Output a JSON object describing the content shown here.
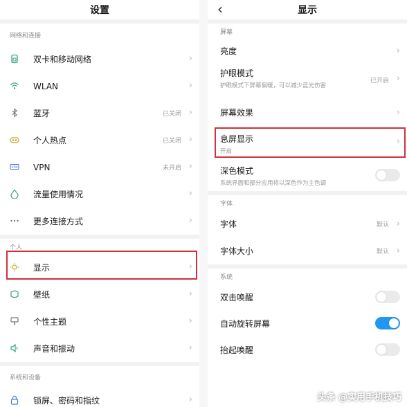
{
  "left": {
    "title": "设置",
    "sections": [
      {
        "header": "网络和连接",
        "items": [
          {
            "icon": "sim-card-icon",
            "label": "双卡和移动网络",
            "value": ""
          },
          {
            "icon": "wifi-icon",
            "label": "WLAN",
            "value": ""
          },
          {
            "icon": "bluetooth-icon",
            "label": "蓝牙",
            "value": "已关闭"
          },
          {
            "icon": "hotspot-icon",
            "label": "个人热点",
            "value": "已关闭"
          },
          {
            "icon": "vpn-icon",
            "label": "VPN",
            "value": "未开启"
          },
          {
            "icon": "data-usage-icon",
            "label": "流量使用情况",
            "value": ""
          },
          {
            "icon": "more-connections-icon",
            "label": "更多连接方式",
            "value": ""
          }
        ]
      },
      {
        "header": "个人",
        "items": [
          {
            "icon": "display-icon",
            "label": "显示",
            "value": ""
          },
          {
            "icon": "wallpaper-icon",
            "label": "壁纸",
            "value": ""
          },
          {
            "icon": "theme-icon",
            "label": "个性主题",
            "value": ""
          },
          {
            "icon": "sound-icon",
            "label": "声音和振动",
            "value": ""
          }
        ]
      },
      {
        "header": "系统和设备",
        "items": [
          {
            "icon": "lock-icon",
            "label": "锁屏、密码和指纹",
            "value": ""
          }
        ]
      }
    ]
  },
  "right": {
    "title": "显示",
    "sections": [
      {
        "header": "屏幕",
        "items": [
          {
            "label": "亮度",
            "sub": "",
            "value": "",
            "control": "chevron"
          },
          {
            "label": "护眼模式",
            "sub": "护眼模式下屏幕偏暖，可以减少蓝光伤害",
            "value": "已开启",
            "control": "chevron"
          },
          {
            "label": "屏幕效果",
            "sub": "",
            "value": "",
            "control": "chevron"
          },
          {
            "label": "息屏显示",
            "sub": "开启",
            "value": "",
            "control": "chevron"
          },
          {
            "label": "深色模式",
            "sub": "系统界面和部分应用将以深色作为主色调",
            "value": "",
            "control": "toggle",
            "on": false
          }
        ]
      },
      {
        "header": "字体",
        "items": [
          {
            "label": "字体",
            "sub": "",
            "value": "默认",
            "control": "chevron"
          },
          {
            "label": "字体大小",
            "sub": "",
            "value": "默认",
            "control": "chevron"
          }
        ]
      },
      {
        "header": "系统",
        "items": [
          {
            "label": "双击唤醒",
            "sub": "",
            "value": "",
            "control": "toggle",
            "on": false
          },
          {
            "label": "自动旋转屏幕",
            "sub": "",
            "value": "",
            "control": "toggle",
            "on": true
          },
          {
            "label": "抬起唤醒",
            "sub": "",
            "value": "",
            "control": "toggle",
            "on": false
          }
        ]
      }
    ]
  },
  "colors": {
    "highlight": "#d0303b",
    "toggle_on": "#2196f3",
    "icon_green": "#3aa57a"
  },
  "watermark": "头条 @实用手机技巧"
}
